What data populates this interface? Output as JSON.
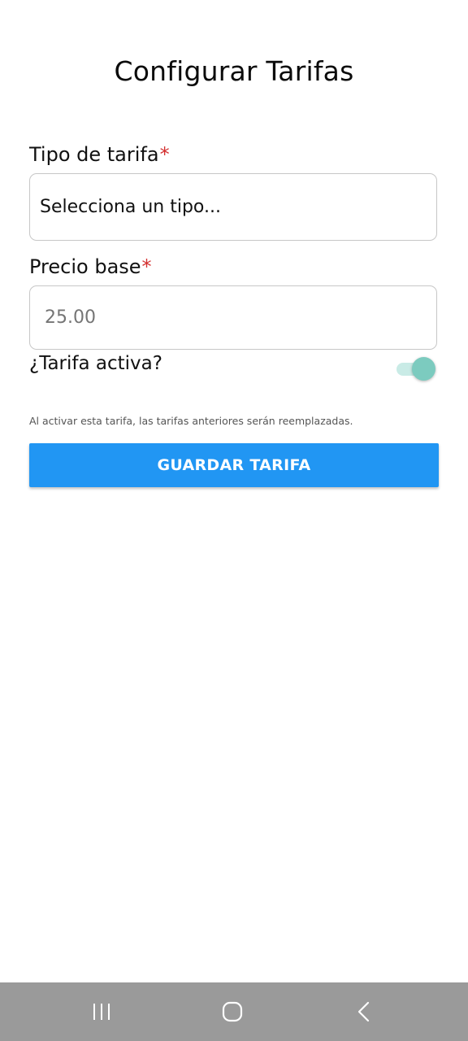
{
  "header": {
    "title": "Configurar Tarifas"
  },
  "form": {
    "tipo": {
      "label": "Tipo de tarifa",
      "required_mark": "*",
      "value": "Selecciona un tipo..."
    },
    "precio": {
      "label": "Precio base",
      "required_mark": "*",
      "placeholder": "25.00"
    },
    "activa": {
      "label": "¿Tarifa activa?",
      "enabled": true
    },
    "hint": "Al activar esta tarifa, las tarifas anteriores serán reemplazadas.",
    "save_label": "GUARDAR TARIFA"
  },
  "colors": {
    "accent": "#2196f3",
    "toggle_on": "#7ccbbf",
    "required": "#d32f2f"
  },
  "nav": {
    "icons": [
      "recents-icon",
      "home-icon",
      "back-icon"
    ]
  }
}
